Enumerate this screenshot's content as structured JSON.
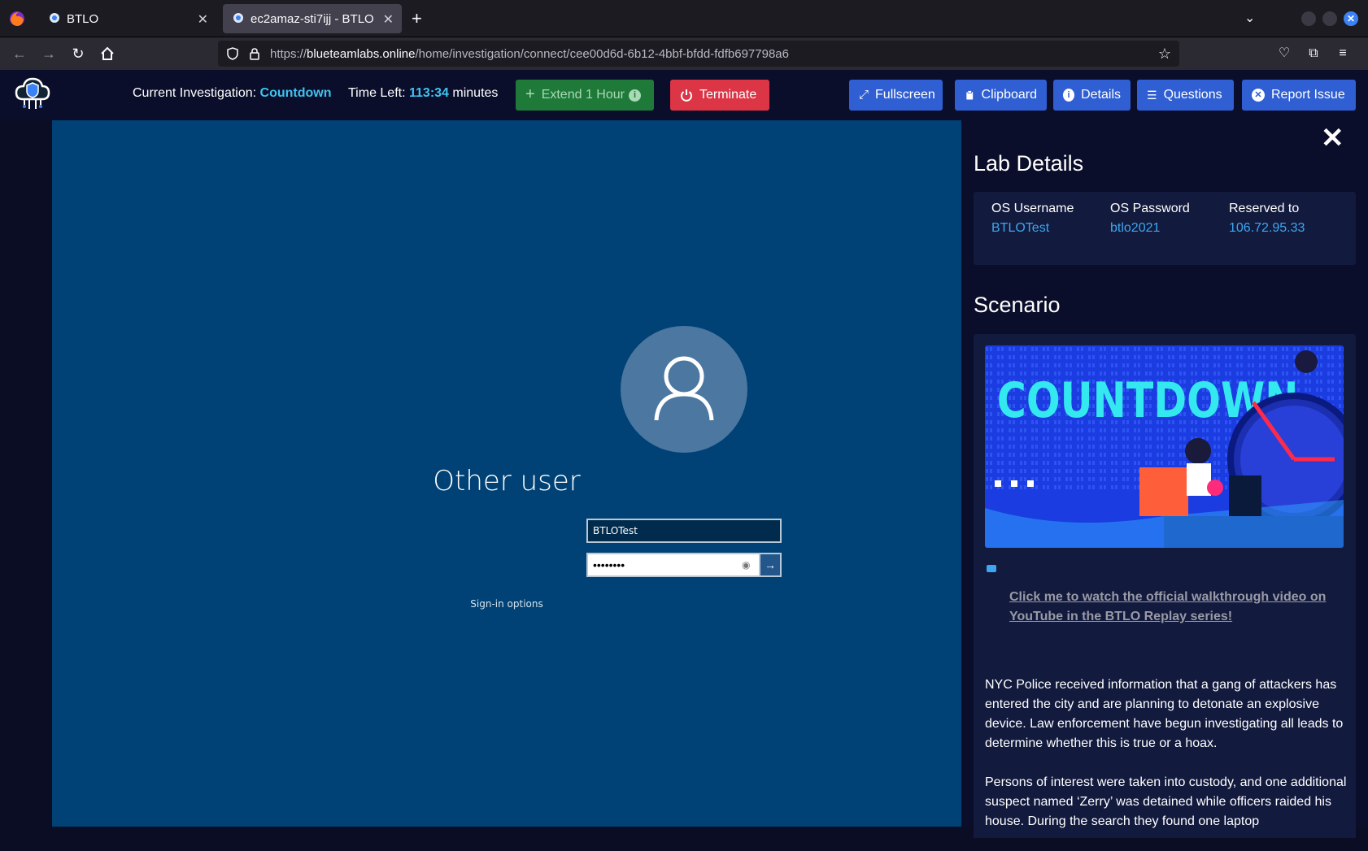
{
  "browser": {
    "tabs": [
      {
        "title": "BTLO"
      },
      {
        "title": "ec2amaz-sti7ijj - BTLO"
      }
    ],
    "url_prefix": "https://",
    "url_domain": "blueteamlabs.online",
    "url_path": "/home/investigation/connect/cee00d6d-6b12-4bbf-bfdd-fdfb697798a6"
  },
  "header": {
    "investigation_label": "Current Investigation:",
    "investigation_name": "Countdown",
    "time_left_label": "Time Left:",
    "time_left_value": "113:34",
    "time_left_unit": "minutes",
    "extend_label": "Extend 1 Hour",
    "terminate_label": "Terminate",
    "fullscreen_label": "Fullscreen",
    "clipboard_label": "Clipboard",
    "details_label": "Details",
    "questions_label": "Questions",
    "report_label": "Report Issue"
  },
  "remote": {
    "user_title": "Other user",
    "username_value": "BTLOTest",
    "password_mask": "••••••••",
    "signin_options": "Sign-in options"
  },
  "panel": {
    "lab_details_title": "Lab Details",
    "os_username_label": "OS Username",
    "os_username_value": "BTLOTest",
    "os_password_label": "OS Password",
    "os_password_value": "btlo2021",
    "reserved_label": "Reserved to",
    "reserved_value": "106.72.95.33",
    "scenario_title": "Scenario",
    "banner_text": "COUNTDOWN",
    "walkthrough_link": "Click me to watch the official walkthrough video on YouTube in the BTLO Replay series!",
    "paragraph1": "NYC Police received information that a gang of attackers has entered the city and are planning to detonate an explosive device. Law enforcement have begun investigating all leads to determine whether this is true or a hoax.",
    "paragraph2": "Persons of interest were taken into custody, and one additional suspect named ‘Zerry’ was detained while officers raided his house. During the search they found one laptop"
  },
  "colors": {
    "accent_cyan": "#3ec3f0",
    "link_blue": "#3ea6f0",
    "button_blue": "#2f5fd3",
    "terminate_red": "#dc3545",
    "extend_green": "#1f7a3a",
    "remote_bg": "#004275"
  }
}
